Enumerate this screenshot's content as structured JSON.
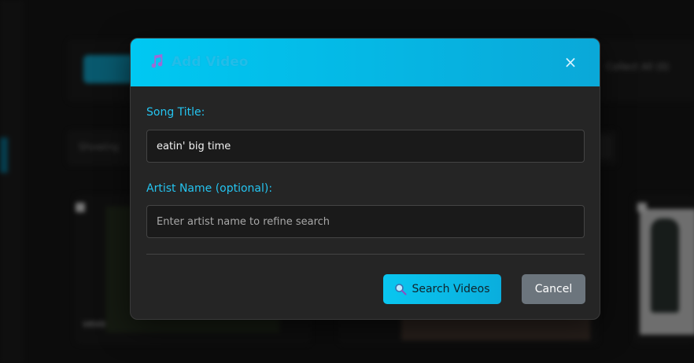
{
  "background": {
    "header_right_text": "Collect All (0)",
    "filter_text": "Showing",
    "watermark": "vevo"
  },
  "modal": {
    "title": "Add Video",
    "title_icon": "music-note-icon",
    "close_glyph": "×",
    "song_title_label": "Song Title:",
    "song_title_value": "eatin' big time",
    "artist_label": "Artist Name (optional):",
    "artist_placeholder": "Enter artist name to refine search",
    "artist_value": "",
    "search_button_label": "Search Videos",
    "search_button_icon": "search-icon",
    "cancel_button_label": "Cancel"
  },
  "colors": {
    "accent": "#00c8f2",
    "label": "#25c4f0",
    "cancel": "#6c757d",
    "icon_purple": "#9b6bd6"
  }
}
